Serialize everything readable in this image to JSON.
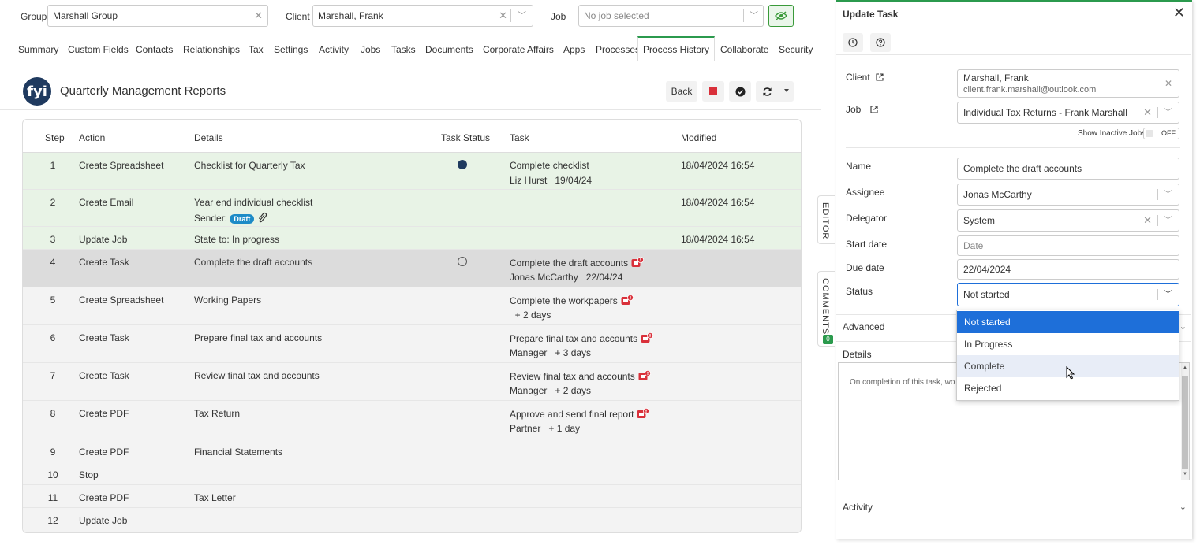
{
  "filters": {
    "group_label": "Group",
    "group_value": "Marshall Group",
    "client_label": "Client",
    "client_value": "Marshall, Frank",
    "job_label": "Job",
    "job_placeholder": "No job selected"
  },
  "tabs": [
    "Summary",
    "Custom Fields",
    "Contacts",
    "Relationships",
    "Tax",
    "Settings",
    "Activity",
    "Jobs",
    "Tasks",
    "Documents",
    "Corporate Affairs",
    "Apps",
    "Processes",
    "Process History",
    "Collaborate",
    "Security"
  ],
  "active_tab": "Process History",
  "header": {
    "logo_text": "fyi",
    "title": "Quarterly Management Reports",
    "back_label": "Back"
  },
  "table": {
    "columns": {
      "step": "Step",
      "action": "Action",
      "details": "Details",
      "task_status": "Task Status",
      "task": "Task",
      "modified": "Modified"
    },
    "rows": [
      {
        "step": "1",
        "action": "Create Spreadsheet",
        "details": "Checklist for Quarterly Tax",
        "details2": "",
        "task": "Complete checklist",
        "task2": "Liz Hurst   19/04/24",
        "modified": "18/04/2024 16:54"
      },
      {
        "step": "2",
        "action": "Create Email",
        "details": "Year end individual checklist",
        "details2": "Sender:",
        "draft": "Draft",
        "task": "",
        "task2": "",
        "modified": "18/04/2024 16:54"
      },
      {
        "step": "3",
        "action": "Update Job",
        "details": "State to:  In progress",
        "details2": "",
        "task": "",
        "task2": "",
        "modified": "18/04/2024 16:54"
      },
      {
        "step": "4",
        "action": "Create Task",
        "details": "Complete the draft accounts",
        "details2": "",
        "task": "Complete the draft accounts",
        "task2": "Jonas McCarthy   22/04/24",
        "modified": ""
      },
      {
        "step": "5",
        "action": "Create Spreadsheet",
        "details": "Working Papers",
        "details2": "",
        "task": "Complete the workpapers",
        "task2": "  + 2 days",
        "modified": ""
      },
      {
        "step": "6",
        "action": "Create Task",
        "details": "Prepare final tax and accounts",
        "details2": "",
        "task": "Prepare final tax and accounts",
        "task2": "Manager   + 3 days",
        "modified": ""
      },
      {
        "step": "7",
        "action": "Create Task",
        "details": "Review final tax and accounts",
        "details2": "",
        "task": "Review final tax and accounts",
        "task2": "Manager   + 2 days",
        "modified": ""
      },
      {
        "step": "8",
        "action": "Create PDF",
        "details": "Tax Return",
        "details2": "",
        "task": "Approve and send final report",
        "task2": "Partner   + 1 day",
        "modified": ""
      },
      {
        "step": "9",
        "action": "Create PDF",
        "details": "Financial Statements",
        "details2": "",
        "task": "",
        "task2": "",
        "modified": ""
      },
      {
        "step": "10",
        "action": "Stop",
        "details": "",
        "details2": "",
        "task": "",
        "task2": "",
        "modified": ""
      },
      {
        "step": "11",
        "action": "Create PDF",
        "details": "Tax Letter",
        "details2": "",
        "task": "",
        "task2": "",
        "modified": ""
      },
      {
        "step": "12",
        "action": "Update Job",
        "details": "",
        "details2": "",
        "task": "",
        "task2": "",
        "modified": ""
      }
    ]
  },
  "side_tabs": {
    "editor": "EDITOR",
    "comments": "COMMENTS",
    "comments_count": "0"
  },
  "panel": {
    "title": "Update Task",
    "client_label": "Client",
    "client_name": "Marshall, Frank",
    "client_email": "client.frank.marshall@outlook.com",
    "job_label": "Job",
    "job_value": "Individual Tax Returns - Frank Marshall",
    "show_inactive_label": "Show Inactive Jobs",
    "show_inactive_state": "OFF",
    "name_label": "Name",
    "name_value": "Complete the draft accounts",
    "assignee_label": "Assignee",
    "assignee_value": "Jonas McCarthy",
    "delegator_label": "Delegator",
    "delegator_value": "System",
    "start_label": "Start date",
    "start_placeholder": "Date",
    "due_label": "Due date",
    "due_value": "22/04/2024",
    "status_label": "Status",
    "status_value": "Not started",
    "advanced_label": "Advanced",
    "details_label": "Details",
    "details_text": "On completion of this task, wo",
    "activity_label": "Activity"
  },
  "status_options": [
    "Not started",
    "In Progress",
    "Complete",
    "Rejected"
  ],
  "colors": {
    "accent_green": "#2b9a4d",
    "done_row": "#e8f3e6",
    "current_row": "#dcdcdc",
    "selected_option": "#1e6fd9",
    "draft_badge": "#1d8bc7",
    "alert_red": "#d9303a",
    "navy": "#1f3a5f"
  }
}
